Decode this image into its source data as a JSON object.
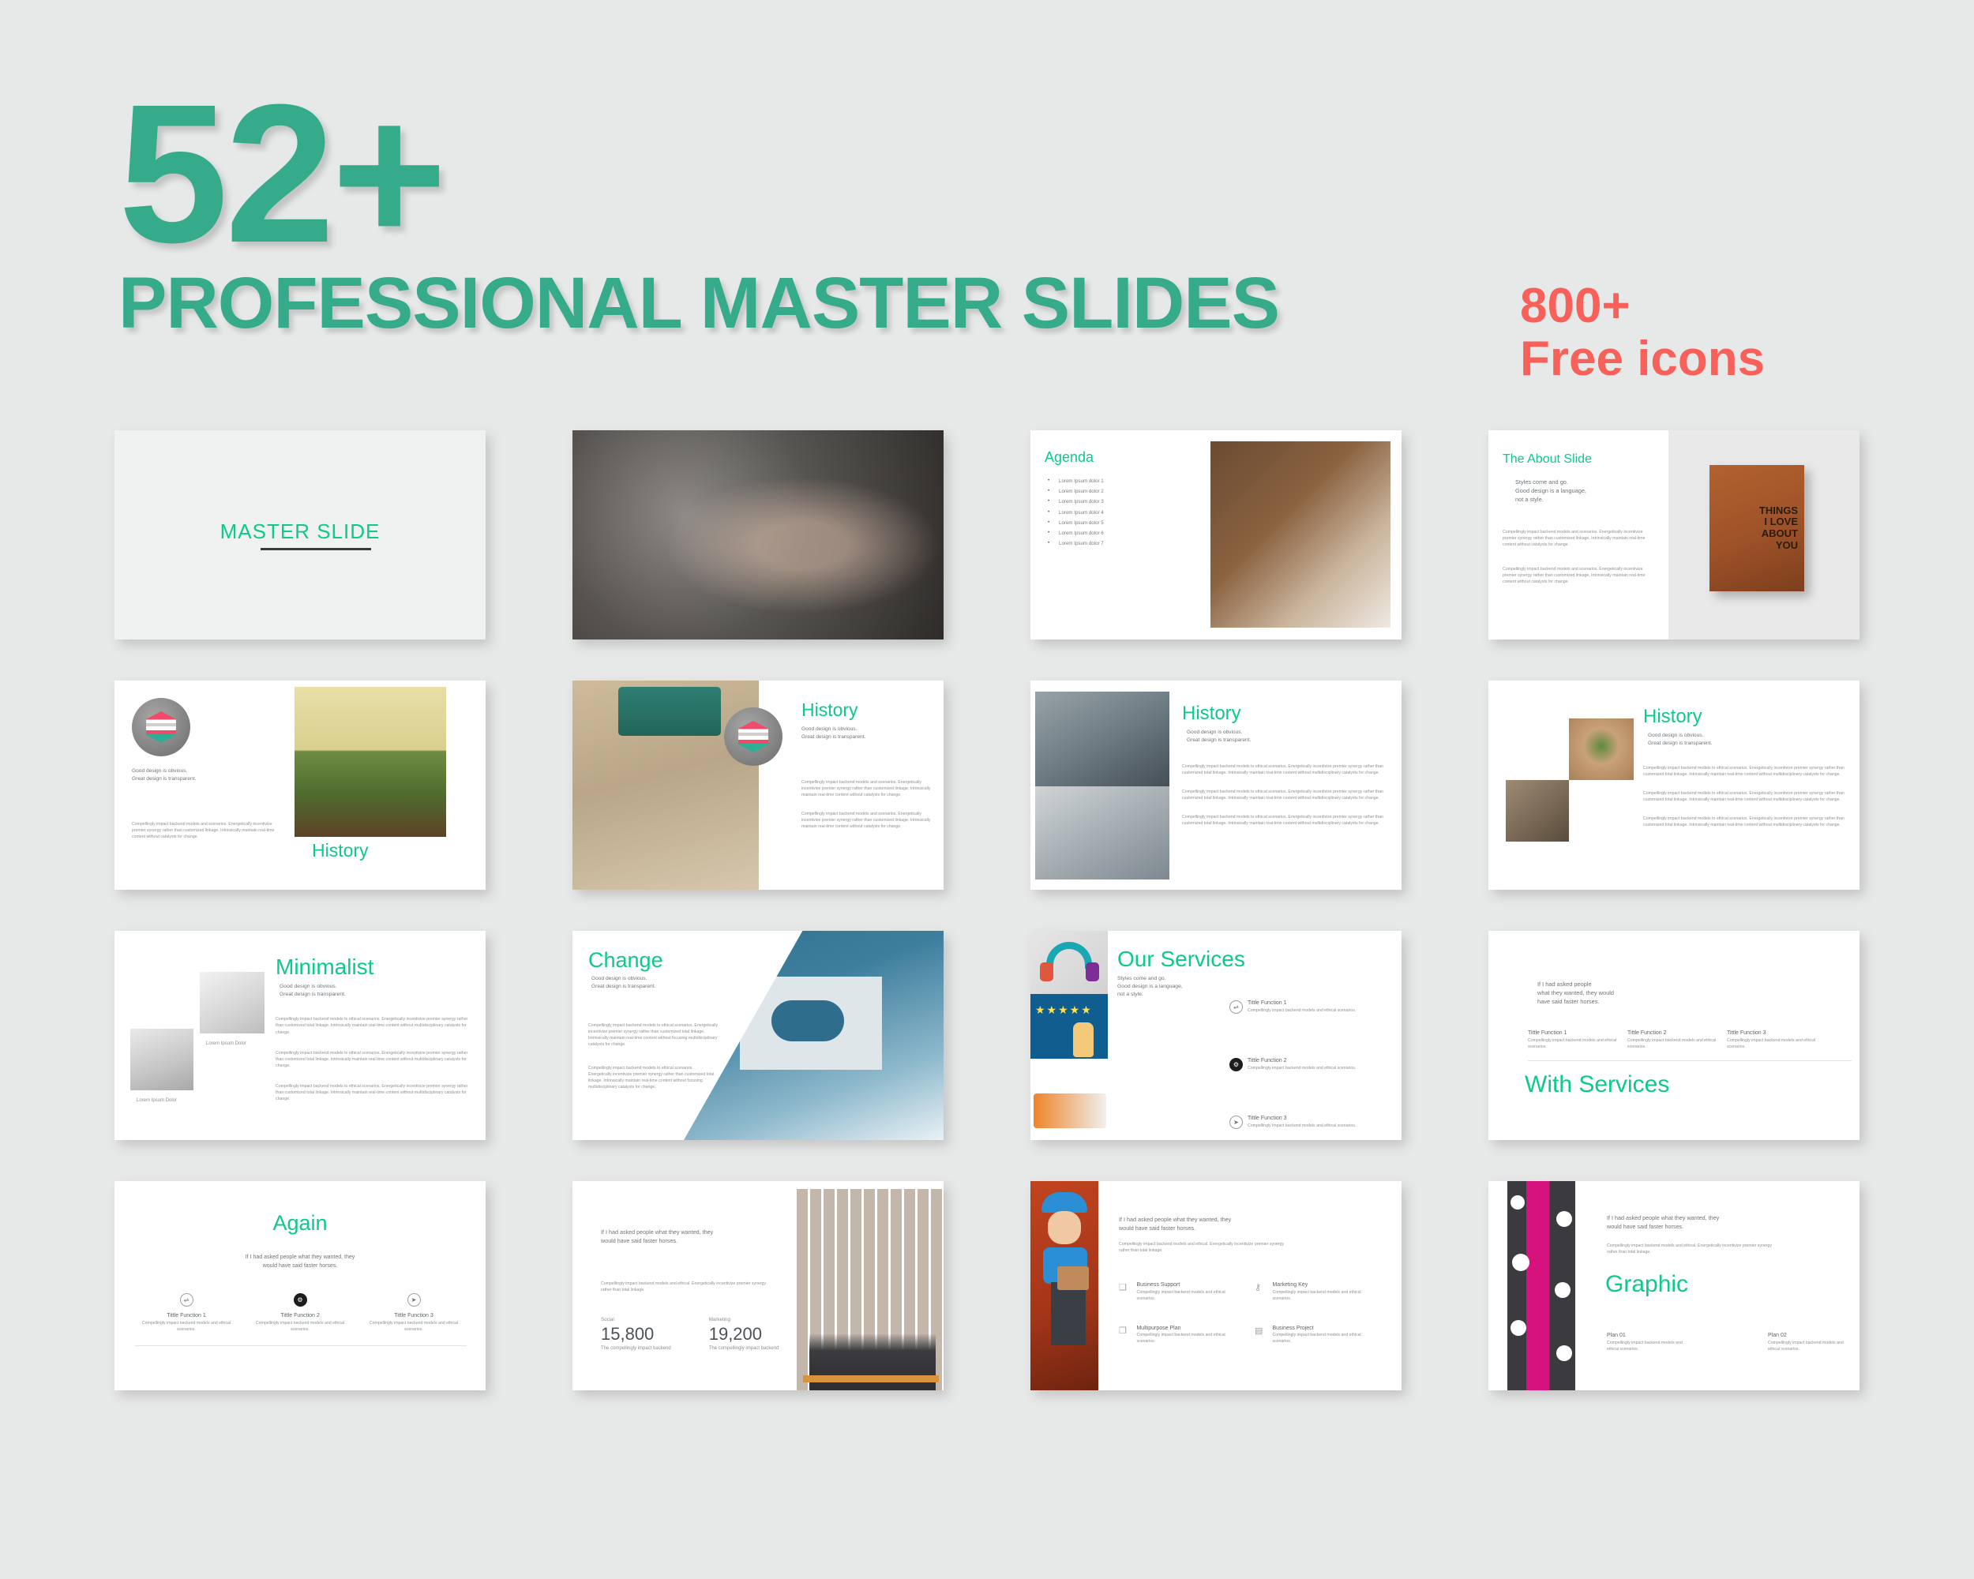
{
  "hero": {
    "number": "52+",
    "title": "PROFESSIONAL MASTER SLIDES",
    "icons_count": "800+",
    "icons_label": "Free icons",
    "accent_teal": "#35ab8c",
    "slide_teal": "#0dc98b",
    "accent_coral": "#f8615a",
    "background": "#e7e8e8"
  },
  "common": {
    "quote_design": "Good design is obvious.\nGreat design is transparent.",
    "quote_design_l1": "Good design is obvious.",
    "quote_design_l2": "Great design is transparent.",
    "quote_styles_l1": "Styles come and go.",
    "quote_styles_l2": "Good design is a language,",
    "quote_styles_l3": "not a style.",
    "quote_horses": "If I had asked people what they wanted, they would have said faster horses.",
    "quote_horses_l1": "If I had asked people",
    "quote_horses_l2": "what they wanted, they would",
    "quote_horses_l3": "have said faster horses.",
    "quote_horses_a1": "If I had asked people what they wanted, they",
    "quote_horses_a2": "would have said faster horses.",
    "lorem_long": "Compellingly impact backend models and scenarios. Energetically incentivize premier synergy rather than customized linkage. Intrinsically maintain real-time content without catalysts for change.",
    "lorem_ethical": "Compellingly impact backend models to ethical scenarios. Energetically incentivize premier synergy rather than customized total linkage. Intrinsically maintain real-time content without multidisciplinary catalysts for change.",
    "lorem_focus": "Compellingly impact backend models to ethical scenarios. Energetically incentivize premier synergy rather than customized total linkage. Intrinsically maintain real-time content without focusing multidisciplinary catalysts for change.",
    "lorem_short": "Compellingly impact backend models and ethical scenarios.",
    "lorem_total": "Compellingly impact backend models and ethical. Energetically incentivize premier synergy rather than total linkage.",
    "caption_dolor": "Lorem Ipsum Dolor"
  },
  "slides": [
    {
      "id": "master-slide",
      "title": "MASTER SLIDE"
    },
    {
      "id": "photo-slide",
      "image": "woman-phone-in-car-photo"
    },
    {
      "id": "agenda-slide",
      "title": "Agenda",
      "image": "business-desk-laptop-coffee-photo",
      "bullets": [
        "Lorem Ipsum dolor 1",
        "Lorem Ipsum dolor 2",
        "Lorem Ipsum dolor 3",
        "Lorem Ipsum dolor 4",
        "Lorem Ipsum dolor 5",
        "Lorem Ipsum dolor 6",
        "Lorem Ipsum dolor 7"
      ]
    },
    {
      "id": "about-slide",
      "title": "The About Slide",
      "image": "leather-notebook-photo",
      "image_text": "THINGS I LOVE ABOUT YOU",
      "image_text_lines": [
        "THINGS",
        "I LOVE",
        "ABOUT",
        "YOU"
      ]
    },
    {
      "id": "history-logo-slide",
      "title": "History",
      "image": "surreal-open-book-photo",
      "logo": "hexagon-layers-logo"
    },
    {
      "id": "history-typewriter-slide",
      "title": "History",
      "image": "vintage-typewriter-photo",
      "logo": "hexagon-layers-logo"
    },
    {
      "id": "history-meeting-slide",
      "title": "History",
      "image": "team-meeting-photo"
    },
    {
      "id": "history-hands-slide",
      "title": "History",
      "image": "hands-circle-grass-photo"
    },
    {
      "id": "minimalist-slide",
      "title": "Minimalist",
      "image": "white-desk-tablet-photo"
    },
    {
      "id": "change-slide",
      "title": "Change",
      "image": "hand-holding-cloud-cutout-photo"
    },
    {
      "id": "our-services-slide",
      "title": "Our Services",
      "images": [
        "headset-icon-graphic",
        "five-stars-bottle-graphic",
        "call-center-figures-graphic"
      ],
      "functions": [
        {
          "title": "Tittle Function 1",
          "icon": "sliders-icon"
        },
        {
          "title": "Tittle Function 2",
          "icon": "gear-icon"
        },
        {
          "title": "Tittle Function 3",
          "icon": "paper-plane-icon"
        }
      ]
    },
    {
      "id": "with-services-slide",
      "title": "With Services",
      "functions": [
        {
          "title": "Tittle Function 1"
        },
        {
          "title": "Tittle Function 2"
        },
        {
          "title": "Tittle Function 3"
        }
      ]
    },
    {
      "id": "again-slide",
      "title": "Again",
      "functions": [
        {
          "title": "Tittle Function 1",
          "icon": "sliders-icon"
        },
        {
          "title": "Tittle Function 2",
          "icon": "gear-icon"
        },
        {
          "title": "Tittle Function 3",
          "icon": "paper-plane-icon"
        }
      ]
    },
    {
      "id": "stats-slide",
      "image": "portrait-wall-bench-photo",
      "stats": [
        {
          "label": "Social",
          "value": "15,800",
          "caption": "The compellingly impact backend"
        },
        {
          "label": "Marketing",
          "value": "19,200",
          "caption": "The compellingly impact backend"
        }
      ]
    },
    {
      "id": "character-slide",
      "image": "delivery-woman-character-graphic",
      "features": [
        {
          "title": "Business Support",
          "icon": "speech-bubble-icon"
        },
        {
          "title": "Marketing Key",
          "icon": "key-icon"
        },
        {
          "title": "Multipurpose Plan",
          "icon": "layers-icon"
        },
        {
          "title": "Business Project",
          "icon": "briefcase-icon"
        }
      ]
    },
    {
      "id": "graphic-slide",
      "title": "Graphic",
      "image": "pink-floral-band-graphic",
      "plans": [
        {
          "title": "Plan 01"
        },
        {
          "title": "Plan 02"
        }
      ]
    }
  ]
}
